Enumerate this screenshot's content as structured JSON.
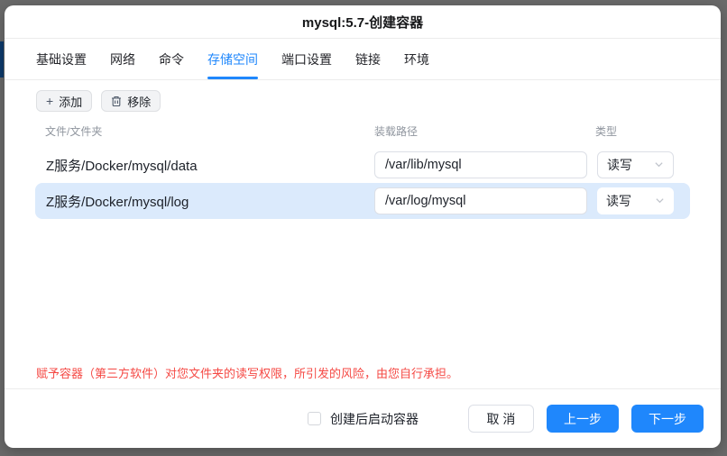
{
  "dialog": {
    "title": "mysql:5.7-创建容器"
  },
  "tabs": [
    {
      "label": "基础设置",
      "active": false
    },
    {
      "label": "网络",
      "active": false
    },
    {
      "label": "命令",
      "active": false
    },
    {
      "label": "存储空间",
      "active": true
    },
    {
      "label": "端口设置",
      "active": false
    },
    {
      "label": "链接",
      "active": false
    },
    {
      "label": "环境",
      "active": false
    }
  ],
  "toolbar": {
    "add_label": "添加",
    "remove_label": "移除"
  },
  "table": {
    "headers": {
      "folder": "文件/文件夹",
      "mount": "装载路径",
      "type": "类型"
    },
    "rows": [
      {
        "folder": "Z服务/Docker/mysql/data",
        "mount_path": "/var/lib/mysql",
        "type": "读写",
        "selected": false
      },
      {
        "folder": "Z服务/Docker/mysql/log",
        "mount_path": "/var/log/mysql",
        "type": "读写",
        "selected": true
      }
    ]
  },
  "warning": "赋予容器（第三方软件）对您文件夹的读写权限，所引发的风险，由您自行承担。",
  "footer": {
    "checkbox_label": "创建后启动容器",
    "checkbox_checked": false,
    "cancel_label": "取 消",
    "prev_label": "上一步",
    "next_label": "下一步"
  },
  "colors": {
    "accent": "#1f87fc",
    "selected_row": "#dbeafc",
    "warning": "#f54a45"
  }
}
